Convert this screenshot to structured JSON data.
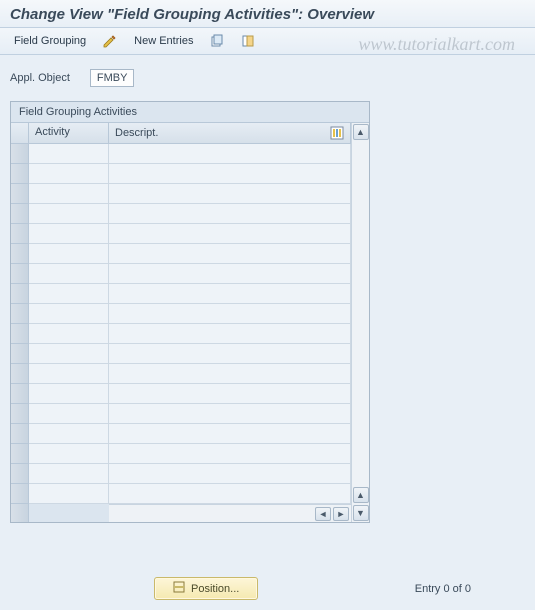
{
  "header": {
    "title": "Change View \"Field Grouping Activities\": Overview"
  },
  "toolbar": {
    "field_grouping": "Field Grouping",
    "new_entries": "New Entries"
  },
  "watermark": "www.tutorialkart.com",
  "appl_object": {
    "label": "Appl. Object",
    "value": "FMBY"
  },
  "panel": {
    "title": "Field Grouping Activities",
    "columns": {
      "activity": "Activity",
      "descript": "Descript."
    },
    "rows": [
      {
        "activity": "",
        "descript": ""
      },
      {
        "activity": "",
        "descript": ""
      },
      {
        "activity": "",
        "descript": ""
      },
      {
        "activity": "",
        "descript": ""
      },
      {
        "activity": "",
        "descript": ""
      },
      {
        "activity": "",
        "descript": ""
      },
      {
        "activity": "",
        "descript": ""
      },
      {
        "activity": "",
        "descript": ""
      },
      {
        "activity": "",
        "descript": ""
      },
      {
        "activity": "",
        "descript": ""
      },
      {
        "activity": "",
        "descript": ""
      },
      {
        "activity": "",
        "descript": ""
      },
      {
        "activity": "",
        "descript": ""
      },
      {
        "activity": "",
        "descript": ""
      },
      {
        "activity": "",
        "descript": ""
      },
      {
        "activity": "",
        "descript": ""
      },
      {
        "activity": "",
        "descript": ""
      },
      {
        "activity": "",
        "descript": ""
      }
    ]
  },
  "footer": {
    "position_label": "Position...",
    "entry_text": "Entry 0 of 0"
  }
}
